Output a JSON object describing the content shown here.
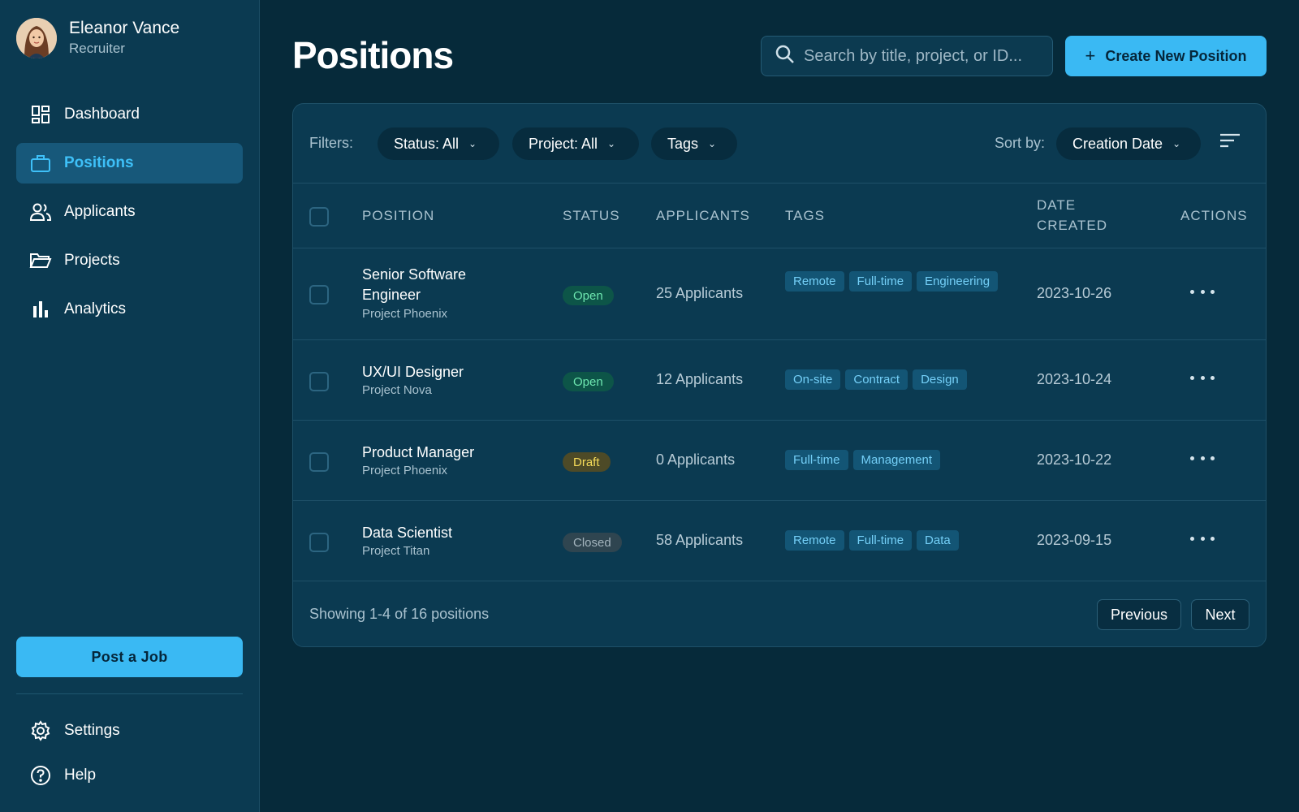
{
  "user": {
    "name": "Eleanor Vance",
    "role": "Recruiter"
  },
  "nav": {
    "items": [
      {
        "label": "Dashboard",
        "icon": "dashboard-icon"
      },
      {
        "label": "Positions",
        "icon": "briefcase-icon",
        "active": true
      },
      {
        "label": "Applicants",
        "icon": "people-icon"
      },
      {
        "label": "Projects",
        "icon": "folder-icon"
      },
      {
        "label": "Analytics",
        "icon": "bar-chart-icon"
      }
    ],
    "post_job": "Post a Job",
    "bottom": [
      {
        "label": "Settings",
        "icon": "gear-icon"
      },
      {
        "label": "Help",
        "icon": "help-circle-icon"
      }
    ]
  },
  "header": {
    "title": "Positions",
    "search_placeholder": "Search by title, project, or ID...",
    "create_button": "Create New Position"
  },
  "filters": {
    "label": "Filters:",
    "status": "Status: All",
    "project": "Project: All",
    "tags": "Tags",
    "sort_label": "Sort by:",
    "sort_value": "Creation Date"
  },
  "table": {
    "columns": {
      "position": "POSITION",
      "status": "STATUS",
      "applicants": "APPLICANTS",
      "tags": "TAGS",
      "date_created_1": "DATE",
      "date_created_2": "CREATED",
      "actions": "ACTIONS"
    },
    "rows": [
      {
        "title_line1": "Senior Software",
        "title_line2": "Engineer",
        "project": "Project Phoenix",
        "status": "Open",
        "applicants": "25 Applicants",
        "tags": [
          "Remote",
          "Full-time",
          "Engineering"
        ],
        "date": "2023-10-26"
      },
      {
        "title_line1": "UX/UI Designer",
        "project": "Project Nova",
        "status": "Open",
        "applicants": "12 Applicants",
        "tags": [
          "On-site",
          "Contract",
          "Design"
        ],
        "date": "2023-10-24"
      },
      {
        "title_line1": "Product Manager",
        "project": "Project Phoenix",
        "status": "Draft",
        "applicants": "0 Applicants",
        "tags": [
          "Full-time",
          "Management"
        ],
        "date": "2023-10-22"
      },
      {
        "title_line1": "Data Scientist",
        "project": "Project Titan",
        "status": "Closed",
        "applicants": "58 Applicants",
        "tags": [
          "Remote",
          "Full-time",
          "Data"
        ],
        "date": "2023-09-15"
      }
    ]
  },
  "pagination": {
    "summary": "Showing 1-4 of 16 positions",
    "previous": "Previous",
    "next": "Next"
  },
  "colors": {
    "accent": "#3ab9f3",
    "background": "#062a3a",
    "panel": "#0b3a51",
    "open": "#6ee7b0",
    "draft": "#f6dc5a",
    "closed": "#a3b4bd"
  }
}
